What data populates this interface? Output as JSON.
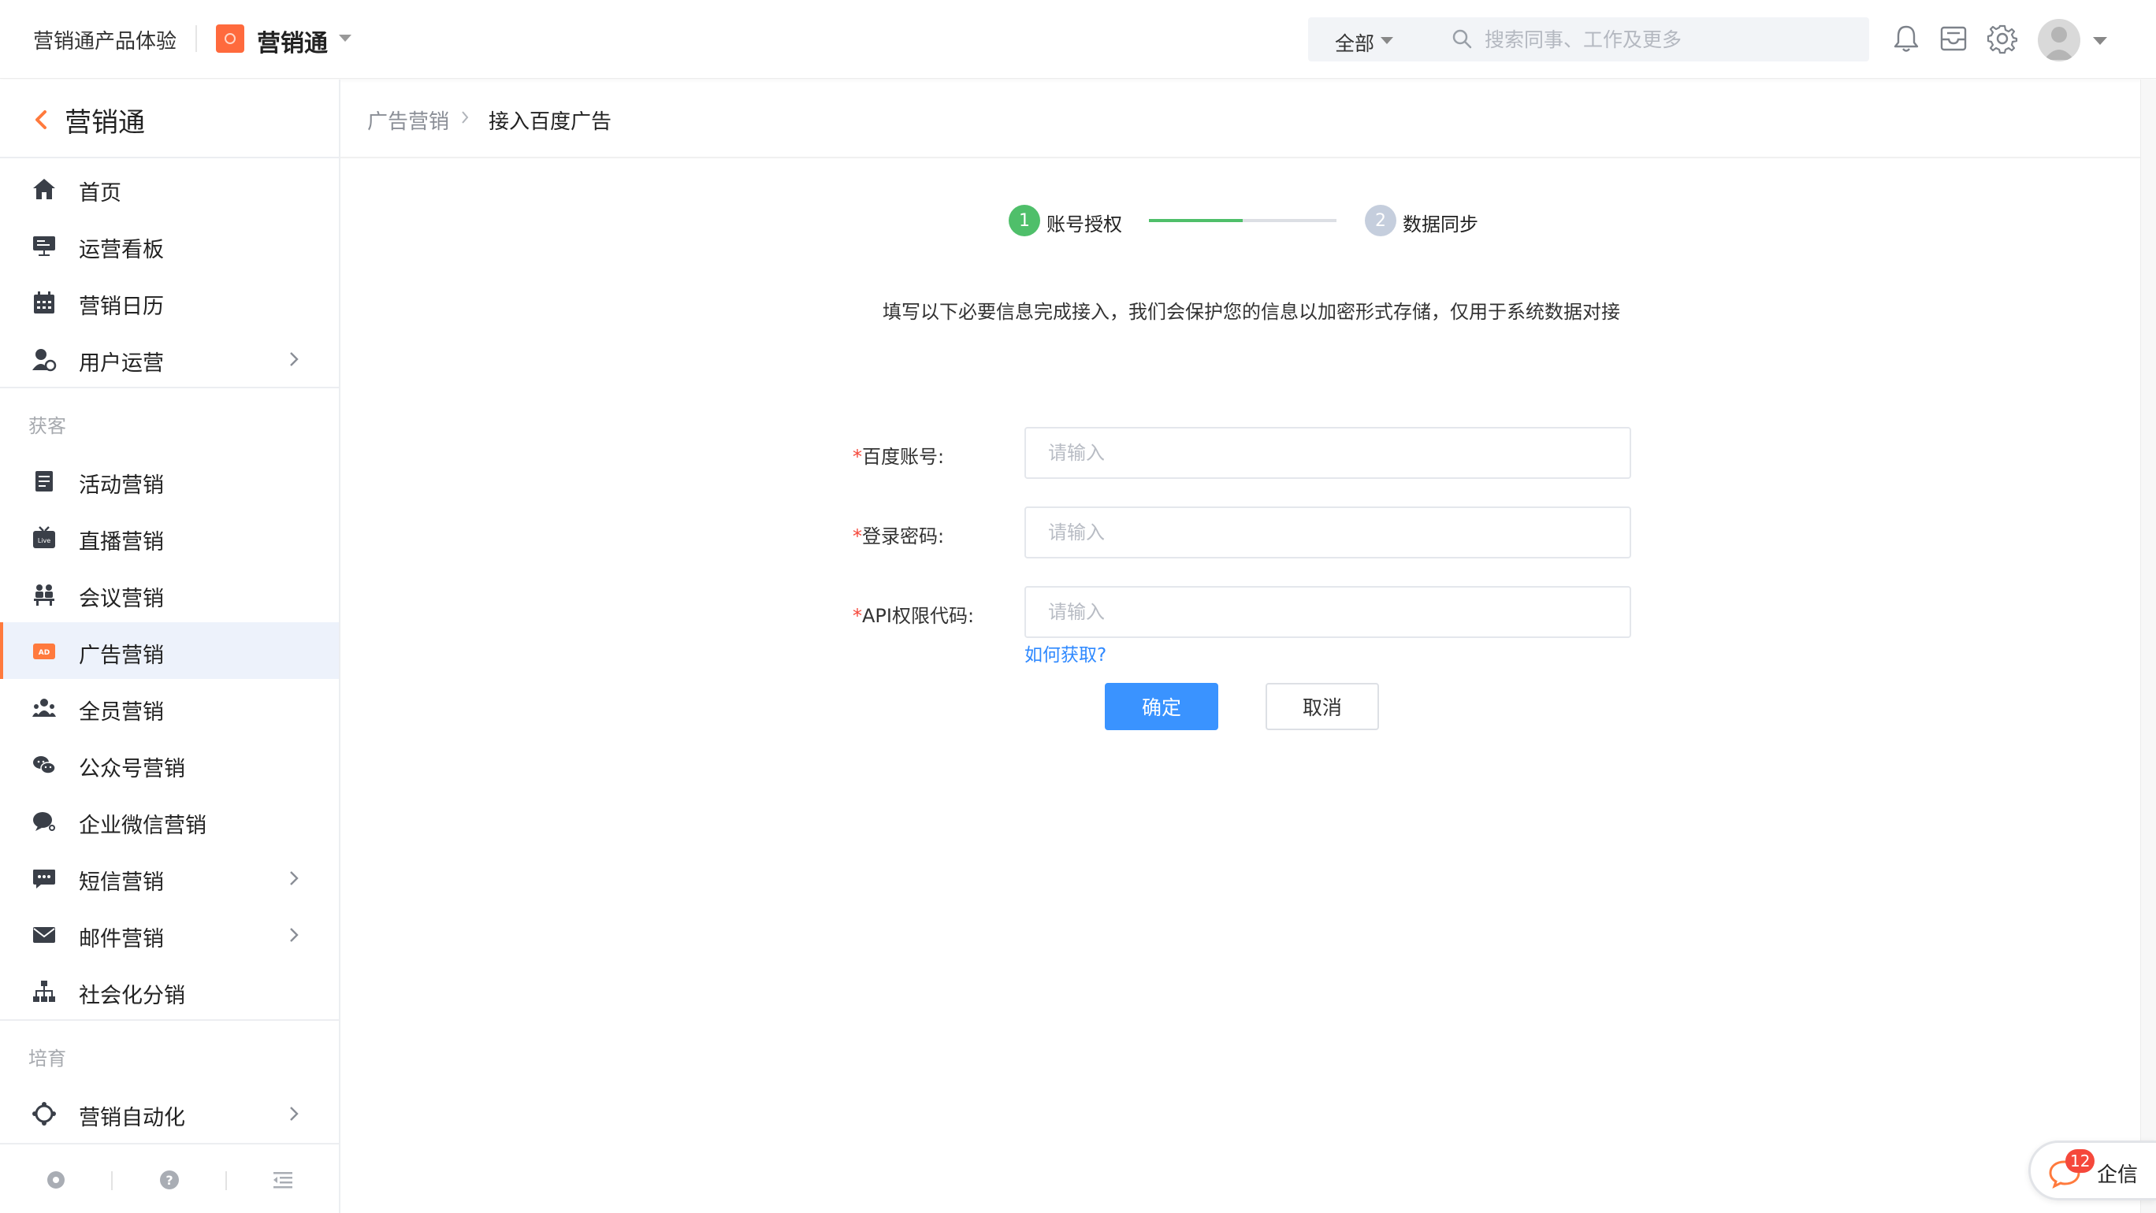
{
  "topbar": {
    "org_name": "营销通产品体验",
    "app_name": "营销通",
    "search_scope": "全部",
    "search_placeholder": "搜索同事、工作及更多"
  },
  "sidebar": {
    "title": "营销通",
    "items": [
      {
        "label": "首页",
        "icon": "home-icon"
      },
      {
        "label": "运营看板",
        "icon": "dashboard-icon"
      },
      {
        "label": "营销日历",
        "icon": "calendar-icon"
      },
      {
        "label": "用户运营",
        "icon": "user-ops-icon",
        "has_children": true
      }
    ],
    "section_acquire": "获客",
    "acquire_items": [
      {
        "label": "活动营销",
        "icon": "activity-icon"
      },
      {
        "label": "直播营销",
        "icon": "live-icon"
      },
      {
        "label": "会议营销",
        "icon": "meeting-icon"
      },
      {
        "label": "广告营销",
        "icon": "ad-icon",
        "active": true
      },
      {
        "label": "全员营销",
        "icon": "team-icon"
      },
      {
        "label": "公众号营销",
        "icon": "wechat-official-icon"
      },
      {
        "label": "企业微信营销",
        "icon": "wecom-icon"
      },
      {
        "label": "短信营销",
        "icon": "sms-icon",
        "has_children": true
      },
      {
        "label": "邮件营销",
        "icon": "mail-icon",
        "has_children": true
      },
      {
        "label": "社会化分销",
        "icon": "distribution-icon"
      }
    ],
    "section_nurture": "培育",
    "nurture_items": [
      {
        "label": "营销自动化",
        "icon": "automation-icon",
        "has_children": true
      }
    ]
  },
  "breadcrumb": {
    "parent": "广告营销",
    "current": "接入百度广告"
  },
  "steps": {
    "step1_number": "1",
    "step1_label": "账号授权",
    "step2_number": "2",
    "step2_label": "数据同步",
    "progress_fraction": 0.5
  },
  "intro_text": "填写以下必要信息完成接入，我们会保护您的信息以加密形式存储，仅用于系统数据对接",
  "form": {
    "required_mark": "*",
    "account_label": "百度账号:",
    "account_placeholder": "请输入",
    "password_label": "登录密码:",
    "password_placeholder": "请输入",
    "api_label": "API权限代码:",
    "api_placeholder": "请输入",
    "help_link": "如何获取?",
    "confirm": "确定",
    "cancel": "取消"
  },
  "chat": {
    "label": "企信",
    "badge": "12"
  },
  "colors": {
    "accent_orange": "#ff7a3d",
    "primary_blue": "#3a93ff",
    "step_green": "#4fbf6a",
    "required_red": "#f5483b"
  }
}
